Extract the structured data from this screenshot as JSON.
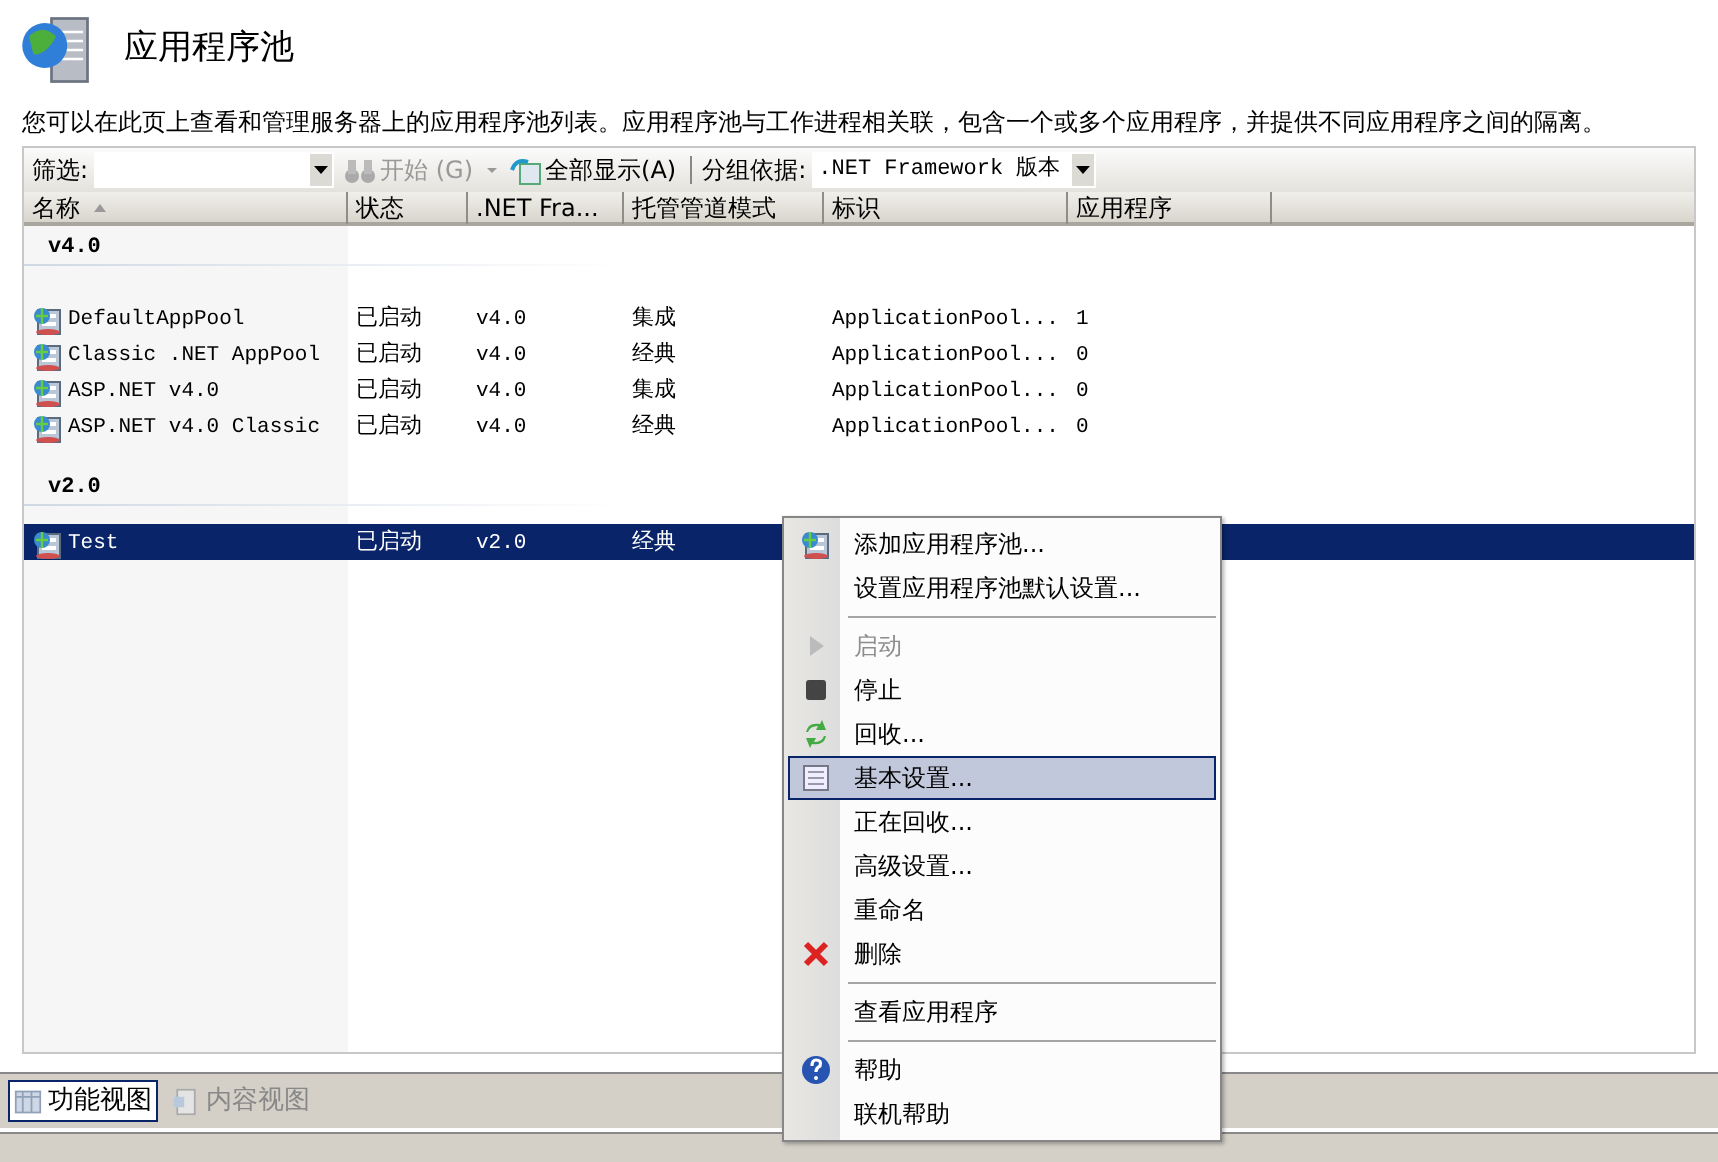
{
  "header": {
    "title": "应用程序池",
    "description": "您可以在此页上查看和管理服务器上的应用程序池列表。应用程序池与工作进程相关联，包含一个或多个应用程序，并提供不同应用程序之间的隔离。"
  },
  "toolbar": {
    "filter_label": "筛选:",
    "start_button": {
      "label": "开始 (G)",
      "disabled": true
    },
    "show_all_button": "全部显示(A)",
    "group_by_label": "分组依据:",
    "group_by_value": ".NET Framework 版本"
  },
  "columns": [
    {
      "label": "名称",
      "sorted": true
    },
    {
      "label": "状态",
      "sorted": false
    },
    {
      "label": ".NET Fra...",
      "sorted": false
    },
    {
      "label": "托管管道模式",
      "sorted": false
    },
    {
      "label": "标识",
      "sorted": false
    },
    {
      "label": "应用程序",
      "sorted": false
    }
  ],
  "groups": [
    {
      "label": "v4.0",
      "rows": [
        {
          "name": "DefaultAppPool",
          "status": "已启动",
          "framework": "v4.0",
          "pipeline": "集成",
          "identity": "ApplicationPool...",
          "applications": "1",
          "selected": false
        },
        {
          "name": "Classic .NET AppPool",
          "status": "已启动",
          "framework": "v4.0",
          "pipeline": "经典",
          "identity": "ApplicationPool...",
          "applications": "0",
          "selected": false
        },
        {
          "name": "ASP.NET v4.0",
          "status": "已启动",
          "framework": "v4.0",
          "pipeline": "集成",
          "identity": "ApplicationPool...",
          "applications": "0",
          "selected": false
        },
        {
          "name": "ASP.NET v4.0 Classic",
          "status": "已启动",
          "framework": "v4.0",
          "pipeline": "经典",
          "identity": "ApplicationPool...",
          "applications": "0",
          "selected": false
        }
      ]
    },
    {
      "label": "v2.0",
      "rows": [
        {
          "name": "Test",
          "status": "已启动",
          "framework": "v2.0",
          "pipeline": "经典",
          "selected": true
        }
      ]
    }
  ],
  "context_menu": {
    "sections": [
      [
        {
          "label": "添加应用程序池...",
          "kind": "add",
          "disabled": false,
          "selected": false
        },
        {
          "label": "设置应用程序池默认设置...",
          "kind": "plain",
          "disabled": false,
          "selected": false
        }
      ],
      [
        {
          "label": "启动",
          "kind": "start",
          "disabled": true,
          "selected": false
        },
        {
          "label": "停止",
          "kind": "stop",
          "disabled": false,
          "selected": false
        },
        {
          "label": "回收...",
          "kind": "recycle",
          "disabled": false,
          "selected": false
        },
        {
          "label": "基本设置...",
          "kind": "settings",
          "disabled": false,
          "selected": true
        },
        {
          "label": "正在回收...",
          "kind": "plain",
          "disabled": false,
          "selected": false
        },
        {
          "label": "高级设置...",
          "kind": "plain",
          "disabled": false,
          "selected": false
        },
        {
          "label": "重命名",
          "kind": "plain",
          "disabled": false,
          "selected": false
        },
        {
          "label": "删除",
          "kind": "delete",
          "disabled": false,
          "selected": false
        }
      ],
      [
        {
          "label": "查看应用程序",
          "kind": "plain",
          "disabled": false,
          "selected": false
        }
      ],
      [
        {
          "label": "帮助",
          "kind": "help",
          "disabled": false,
          "selected": false
        },
        {
          "label": "联机帮助",
          "kind": "plain",
          "disabled": false,
          "selected": false
        }
      ]
    ]
  },
  "view_tabs": [
    {
      "label": "功能视图",
      "selected": true
    },
    {
      "label": "内容视图",
      "selected": false
    }
  ]
}
